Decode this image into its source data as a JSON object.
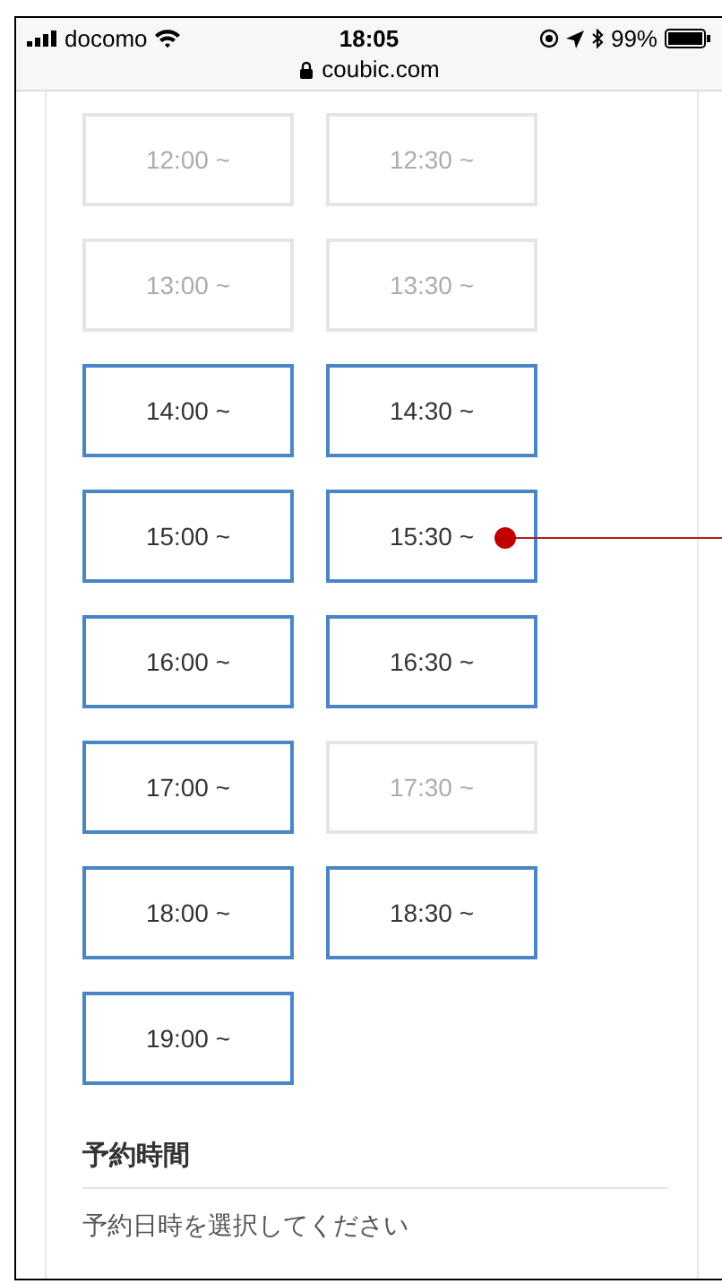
{
  "status_bar": {
    "carrier": "docomo",
    "time": "18:05",
    "battery": "99%",
    "url": "coubic.com"
  },
  "time_slots": [
    {
      "label": "12:00 ~",
      "disabled": true
    },
    {
      "label": "12:30 ~",
      "disabled": true
    },
    {
      "label": "13:00 ~",
      "disabled": true
    },
    {
      "label": "13:30 ~",
      "disabled": true
    },
    {
      "label": "14:00 ~",
      "disabled": false
    },
    {
      "label": "14:30 ~",
      "disabled": false
    },
    {
      "label": "15:00 ~",
      "disabled": false
    },
    {
      "label": "15:30 ~",
      "disabled": false
    },
    {
      "label": "16:00 ~",
      "disabled": false
    },
    {
      "label": "16:30 ~",
      "disabled": false
    },
    {
      "label": "17:00 ~",
      "disabled": false
    },
    {
      "label": "17:30 ~",
      "disabled": true
    },
    {
      "label": "18:00 ~",
      "disabled": false
    },
    {
      "label": "18:30 ~",
      "disabled": false
    },
    {
      "label": "19:00 ~",
      "disabled": false
    }
  ],
  "reservation_time": {
    "heading": "予約時間",
    "text": "予約日時を選択してください"
  }
}
